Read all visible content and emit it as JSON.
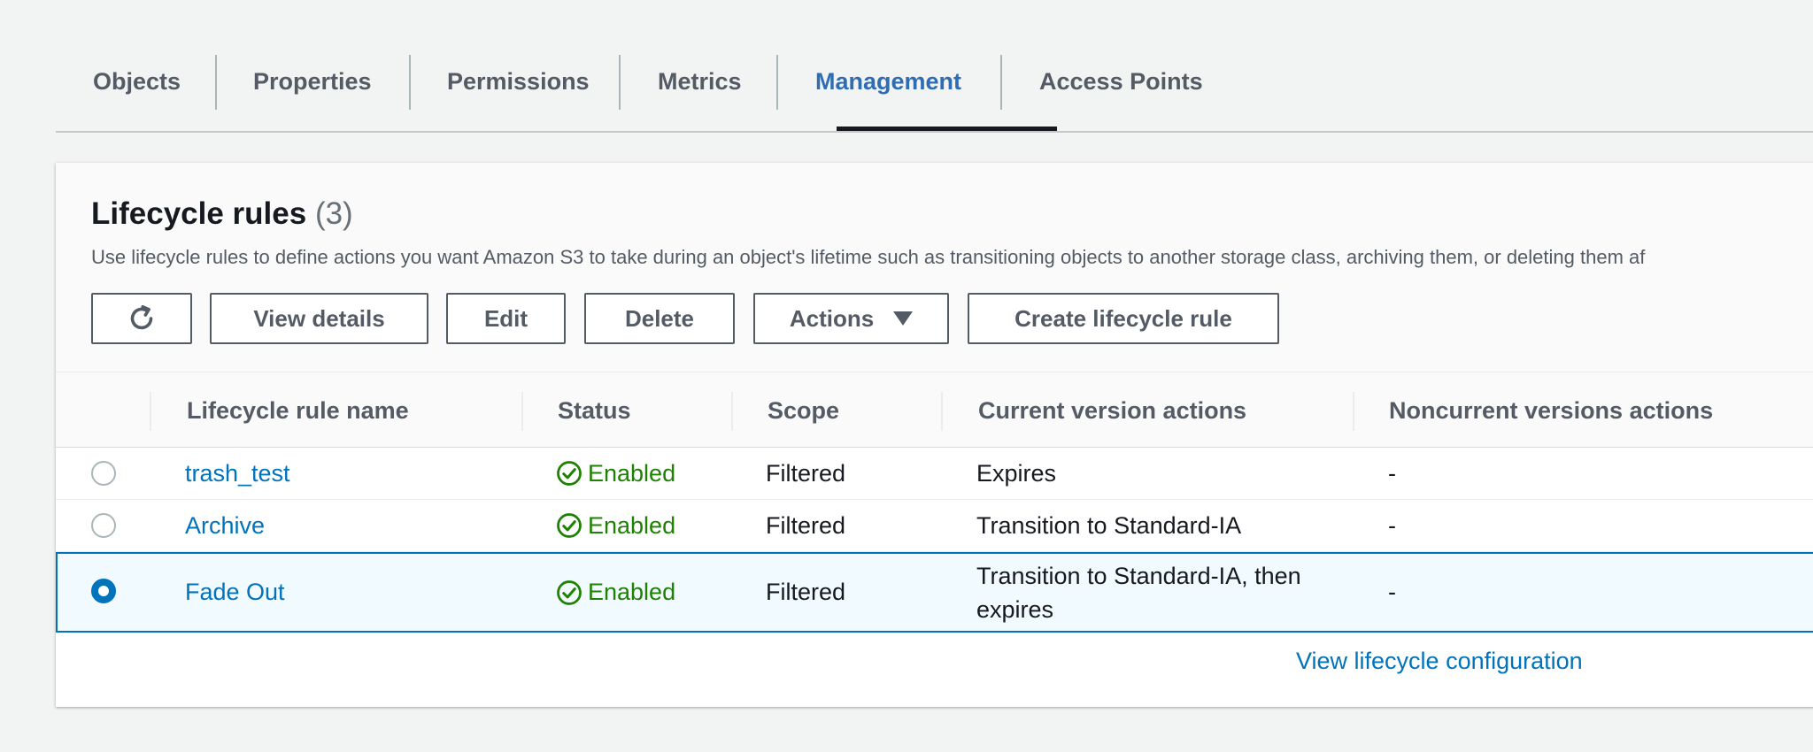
{
  "tabs": [
    {
      "label": "Objects"
    },
    {
      "label": "Properties"
    },
    {
      "label": "Permissions"
    },
    {
      "label": "Metrics"
    },
    {
      "label": "Management"
    },
    {
      "label": "Access Points"
    }
  ],
  "active_tab": "Management",
  "panel": {
    "title": "Lifecycle rules",
    "count": "(3)",
    "description": "Use lifecycle rules to define actions you want Amazon S3 to take during an object's lifetime such as transitioning objects to another storage class, archiving them, or deleting them af"
  },
  "toolbar": {
    "refresh_icon": "refresh-icon",
    "view_details_label": "View details",
    "edit_label": "Edit",
    "delete_label": "Delete",
    "actions_label": "Actions",
    "create_label": "Create lifecycle rule"
  },
  "table": {
    "headers": {
      "name": "Lifecycle rule name",
      "status": "Status",
      "scope": "Scope",
      "current": "Current version actions",
      "noncurrent": "Noncurrent versions actions"
    },
    "rows": [
      {
        "name": "trash_test",
        "status": "Enabled",
        "scope": "Filtered",
        "current": "Expires",
        "noncurrent": "-",
        "selected": false
      },
      {
        "name": "Archive",
        "status": "Enabled",
        "scope": "Filtered",
        "current": "Transition to Standard-IA",
        "noncurrent": "-",
        "selected": false
      },
      {
        "name": "Fade Out",
        "status": "Enabled",
        "scope": "Filtered",
        "current": "Transition to Standard-IA, then expires",
        "noncurrent": "-",
        "selected": true
      }
    ]
  },
  "footer": {
    "view_config_label": "View lifecycle configuration"
  },
  "colors": {
    "accent": "#0073bb",
    "active_tab": "#2e6db4",
    "success": "#1d8102",
    "text": "#16191f",
    "muted": "#545b64"
  }
}
